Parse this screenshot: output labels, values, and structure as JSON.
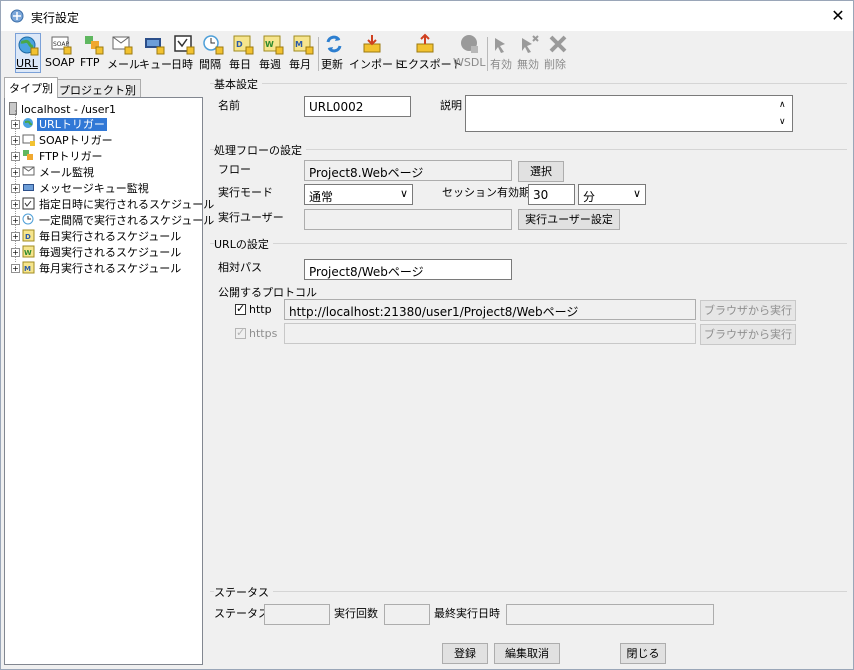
{
  "window": {
    "title": "実行設定",
    "close_glyph": "✕"
  },
  "toolbar": {
    "items": [
      {
        "label": "URL",
        "icon": "url-globe-icon"
      },
      {
        "label": "SOAP",
        "icon": "soap-icon"
      },
      {
        "label": "FTP",
        "icon": "ftp-icon"
      },
      {
        "label": "メール",
        "icon": "mail-icon"
      },
      {
        "label": "キュー",
        "icon": "queue-icon"
      },
      {
        "label": "日時",
        "icon": "datetime-icon"
      },
      {
        "label": "間隔",
        "icon": "interval-icon"
      },
      {
        "label": "毎日",
        "icon": "daily-icon"
      },
      {
        "label": "毎週",
        "icon": "weekly-icon"
      },
      {
        "label": "毎月",
        "icon": "monthly-icon"
      },
      {
        "label": "更新",
        "icon": "refresh-icon"
      },
      {
        "label": "インポート",
        "icon": "import-icon"
      },
      {
        "label": "エクスポート",
        "icon": "export-icon"
      },
      {
        "label": "WSDL",
        "icon": "wsdl-icon"
      },
      {
        "label": "有効",
        "icon": "enable-icon"
      },
      {
        "label": "無効",
        "icon": "disable-icon"
      },
      {
        "label": "削除",
        "icon": "delete-icon"
      }
    ]
  },
  "left": {
    "tabs": [
      "タイプ別",
      "プロジェクト別"
    ],
    "root": "localhost - /user1",
    "tree": [
      "URLトリガー",
      "SOAPトリガー",
      "FTPトリガー",
      "メール監視",
      "メッセージキュー監視",
      "指定日時に実行されるスケジュール",
      "一定間隔で実行されるスケジュール",
      "毎日実行されるスケジュール",
      "毎週実行されるスケジュール",
      "毎月実行されるスケジュール"
    ]
  },
  "basic": {
    "title": "基本設定",
    "name_label": "名前",
    "name_value": "URL0002",
    "desc_label": "説明",
    "desc_value": ""
  },
  "flow": {
    "title": "処理フローの設定",
    "flow_label": "フロー",
    "flow_value": "Project8.Webページ",
    "select_button": "選択",
    "mode_label": "実行モード",
    "mode_value": "通常",
    "session_label": "セッション有効期間",
    "session_value": "30",
    "session_unit": "分",
    "user_label": "実行ユーザー",
    "user_value": "",
    "user_button": "実行ユーザー設定"
  },
  "url": {
    "title": "URLの設定",
    "path_label": "相対パス",
    "path_value": "Project8/Webページ",
    "protocol_label": "公開するプロトコル",
    "http_label": "http",
    "http_url": "http://localhost:21380/user1/Project8/Webページ",
    "http_button": "ブラウザから実行",
    "https_label": "https",
    "https_url": "",
    "https_button": "ブラウザから実行",
    "check_glyph": "✓"
  },
  "status": {
    "title": "ステータス",
    "status_label": "ステータス",
    "status_value": "",
    "count_label": "実行回数",
    "count_value": "",
    "last_label": "最終実行日時",
    "last_value": ""
  },
  "footer": {
    "register": "登録",
    "cancel_edit": "編集取消",
    "close": "閉じる"
  },
  "colors": {
    "selection": "#3178d6",
    "toolbar_selected_bg": "#dce8f8"
  }
}
